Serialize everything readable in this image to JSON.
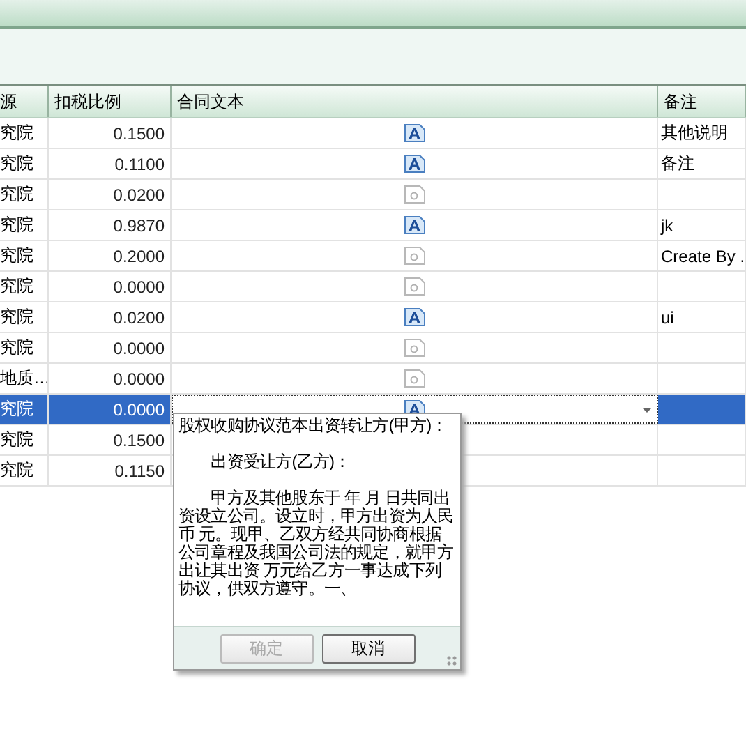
{
  "table": {
    "columns": [
      "源",
      "扣税比例",
      "合同文本",
      "备注"
    ],
    "rows": [
      {
        "source": "究院",
        "ratio": "0.1500",
        "has_text": true,
        "note": "其他说明",
        "selected": false
      },
      {
        "source": "究院",
        "ratio": "0.1100",
        "has_text": true,
        "note": "备注",
        "selected": false
      },
      {
        "source": "究院",
        "ratio": "0.0200",
        "has_text": false,
        "selected": false
      },
      {
        "source": "究院",
        "ratio": "0.9870",
        "has_text": true,
        "note": "jk",
        "selected": false
      },
      {
        "source": "究院",
        "ratio": "0.2000",
        "has_text": false,
        "note": "Create By .",
        "selected": false
      },
      {
        "source": "究院",
        "ratio": "0.0000",
        "has_text": false,
        "selected": false
      },
      {
        "source": "究院",
        "ratio": "0.0200",
        "has_text": true,
        "note": "ui",
        "selected": false
      },
      {
        "source": "究院",
        "ratio": "0.0000",
        "has_text": false,
        "selected": false
      },
      {
        "source": "地质…",
        "ratio": "0.0000",
        "has_text": false,
        "selected": false
      },
      {
        "source": "究院",
        "ratio": "0.0000",
        "has_text": true,
        "selected": true,
        "editing": true
      },
      {
        "source": "究院",
        "ratio": "0.1500",
        "selected": false
      },
      {
        "source": "究院",
        "ratio": "0.1150",
        "selected": false
      }
    ]
  },
  "popup": {
    "paragraphs": [
      "股权收购协议范本出资转让方(甲方)：",
      "　　出资受让方(乙方)：",
      "　　甲方及其他股东于 年 月 日共同出资设立公司。设立时，甲方出资为人民币 元。现甲、乙双方经共同协商根据公司章程及我国公司法的规定，就甲方出让其出资 万元给乙方一事达成下列协议，供双方遵守。一、"
    ],
    "buttons": [
      {
        "label": "确定",
        "disabled": true
      },
      {
        "label": "取消",
        "disabled": false
      }
    ]
  }
}
